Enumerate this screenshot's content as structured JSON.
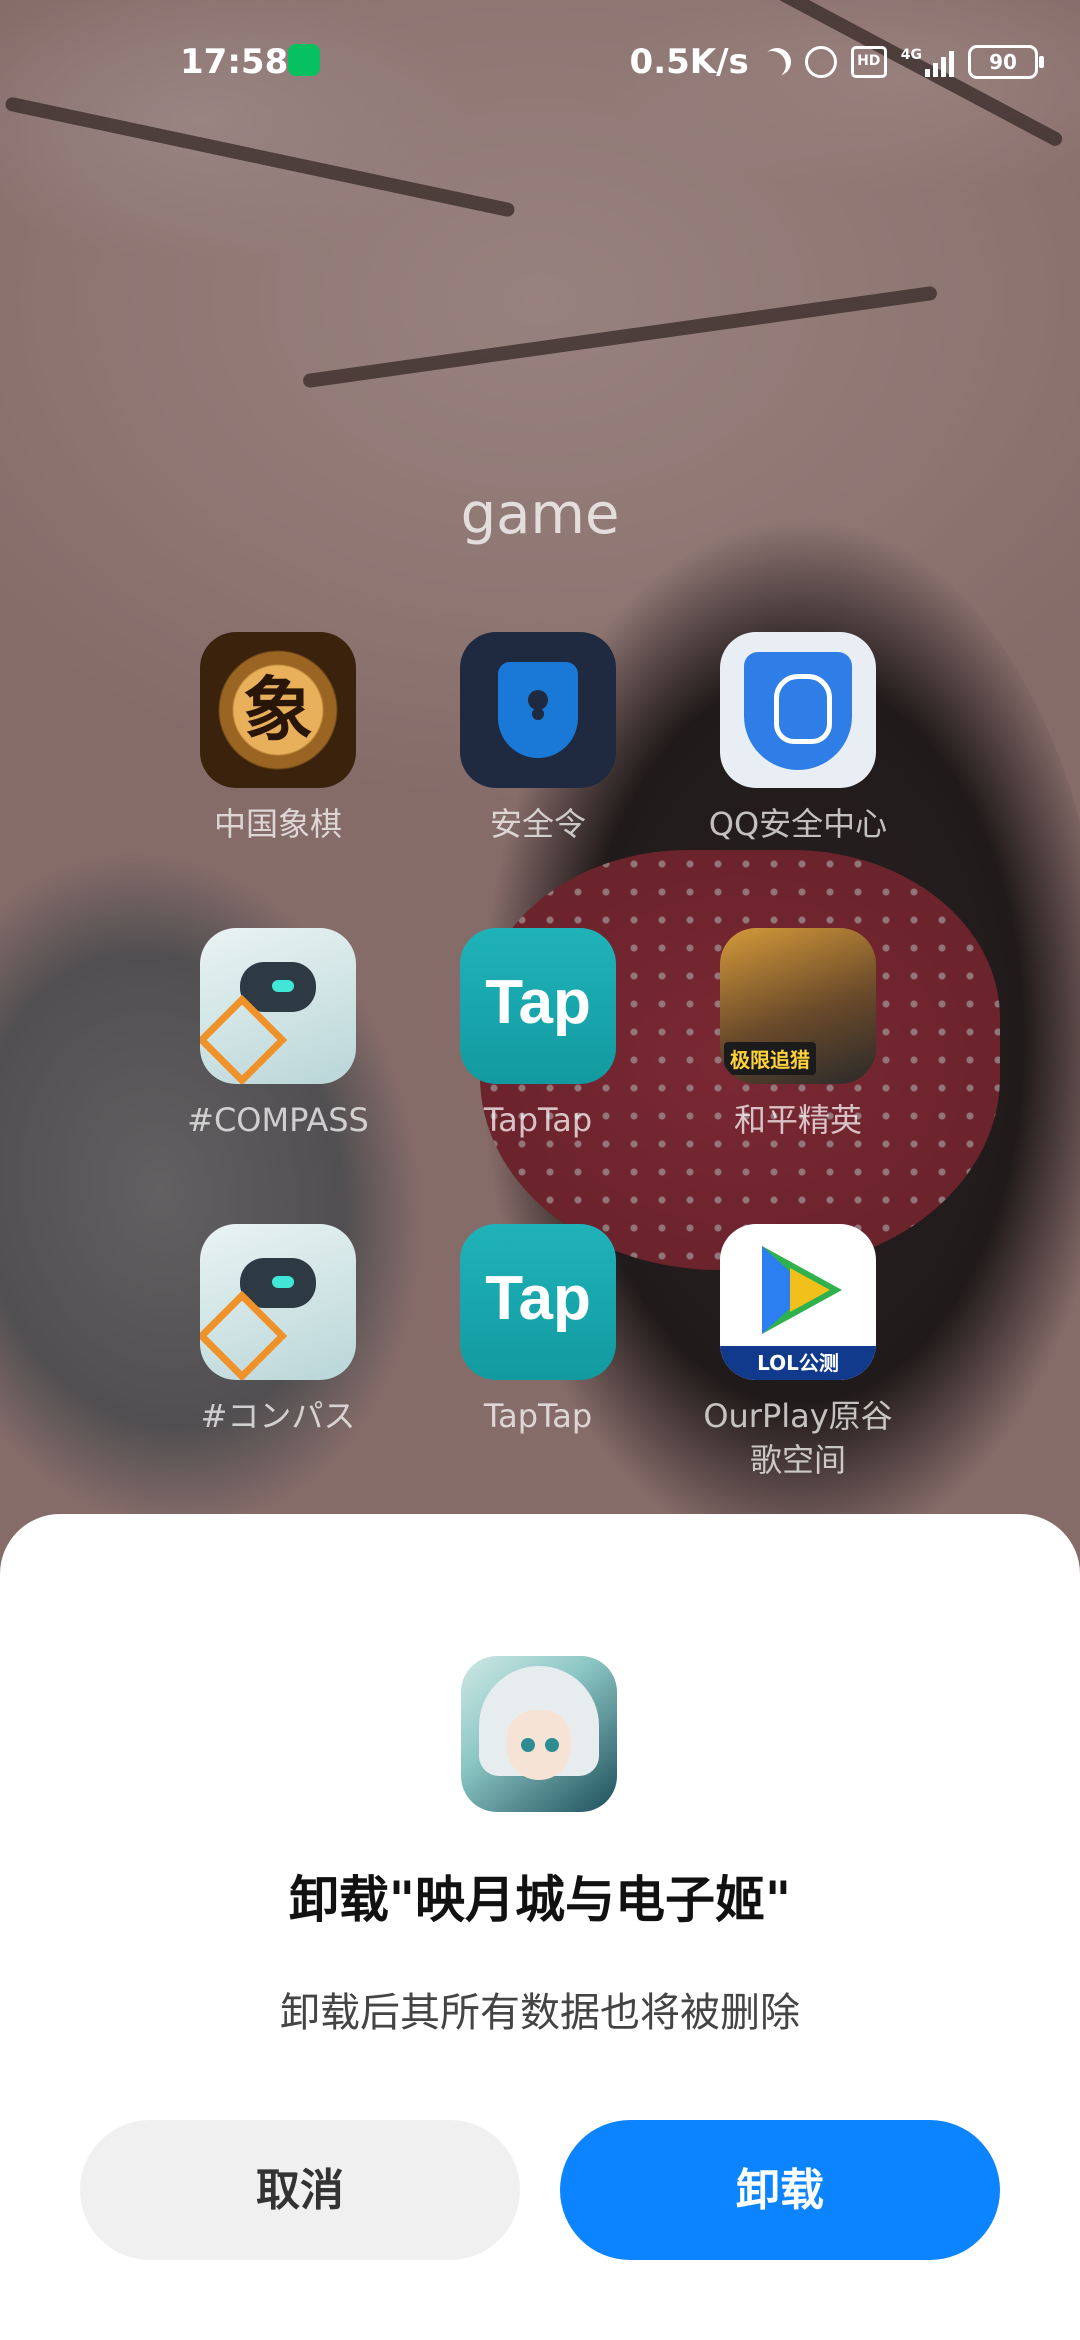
{
  "status_bar": {
    "time": "17:58",
    "network_speed": "0.5K/s",
    "hd_label": "HD",
    "signal_label": "4G",
    "battery": "90",
    "icons": [
      "wechat-icon",
      "moon-icon",
      "alarm-icon",
      "hd-icon",
      "signal-icon",
      "battery-icon"
    ]
  },
  "folder": {
    "title": "game",
    "apps": [
      {
        "label": "中国象棋",
        "icon": "chinese-chess-icon",
        "glyph": "象"
      },
      {
        "label": "安全令",
        "icon": "security-token-icon"
      },
      {
        "label": "QQ安全中心",
        "icon": "qq-security-icon"
      },
      {
        "label": "#COMPASS",
        "icon": "compass-robot-icon"
      },
      {
        "label": "TapTap",
        "icon": "taptap-icon",
        "glyph": "Tap"
      },
      {
        "label": "和平精英",
        "icon": "peacekeeper-elite-icon",
        "tag": "极限追猎"
      },
      {
        "label": "#コンパス",
        "icon": "compass-robot-icon"
      },
      {
        "label": "TapTap",
        "icon": "taptap-icon",
        "glyph": "Tap"
      },
      {
        "label": "OurPlay原谷歌空间",
        "icon": "ourplay-icon",
        "tag": "LOL公测"
      }
    ]
  },
  "dialog": {
    "app_icon": "anime-girl-app-icon",
    "title": "卸载\"映月城与电子姬\"",
    "message": "卸载后其所有数据也将被删除",
    "cancel_label": "取消",
    "confirm_label": "卸载",
    "confirm_color": "#0d84ff",
    "cancel_color": "#f0f0f0"
  }
}
